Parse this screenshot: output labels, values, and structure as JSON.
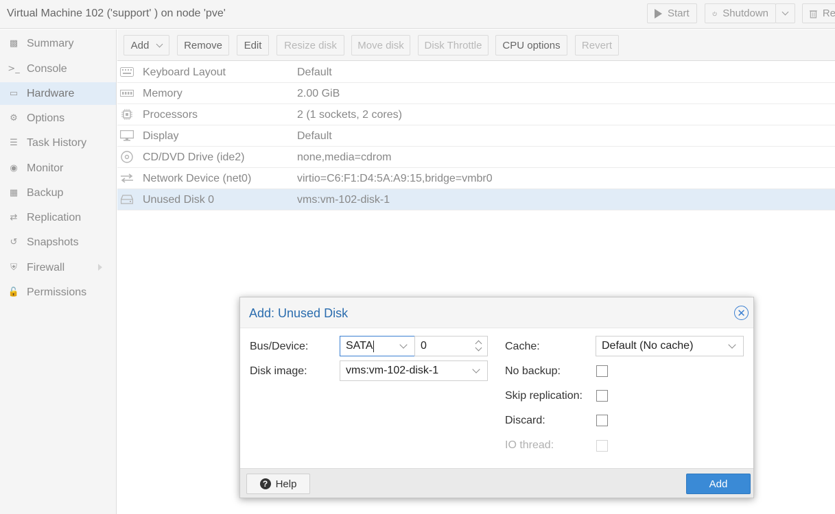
{
  "header": {
    "title": "Virtual Machine 102 ('support' ) on node 'pve'",
    "start_label": "Start",
    "shutdown_label": "Shutdown",
    "remove_label": "Re"
  },
  "sidebar": {
    "items": [
      {
        "label": "Summary",
        "icon": "book-icon"
      },
      {
        "label": "Console",
        "icon": "terminal-icon"
      },
      {
        "label": "Hardware",
        "icon": "desktop-icon",
        "active": true
      },
      {
        "label": "Options",
        "icon": "gear-icon"
      },
      {
        "label": "Task History",
        "icon": "list-icon"
      },
      {
        "label": "Monitor",
        "icon": "eye-icon"
      },
      {
        "label": "Backup",
        "icon": "floppy-icon"
      },
      {
        "label": "Replication",
        "icon": "retweet-icon"
      },
      {
        "label": "Snapshots",
        "icon": "history-icon"
      },
      {
        "label": "Firewall",
        "icon": "shield-icon"
      },
      {
        "label": "Permissions",
        "icon": "unlock-icon"
      }
    ]
  },
  "toolbar": {
    "add": "Add",
    "remove": "Remove",
    "edit": "Edit",
    "resize_disk": "Resize disk",
    "move_disk": "Move disk",
    "disk_throttle": "Disk Throttle",
    "cpu_options": "CPU options",
    "revert": "Revert"
  },
  "hardware": [
    {
      "name": "Keyboard Layout",
      "value": "Default",
      "icon": "keyboard-icon"
    },
    {
      "name": "Memory",
      "value": "2.00 GiB",
      "icon": "memory-icon"
    },
    {
      "name": "Processors",
      "value": "2 (1 sockets, 2 cores)",
      "icon": "cpu-icon"
    },
    {
      "name": "Display",
      "value": "Default",
      "icon": "desktop-icon"
    },
    {
      "name": "CD/DVD Drive (ide2)",
      "value": "none,media=cdrom",
      "icon": "cdrom-icon"
    },
    {
      "name": "Network Device (net0)",
      "value": "virtio=C6:F1:D4:5A:A9:15,bridge=vmbr0",
      "icon": "exchange-icon"
    },
    {
      "name": "Unused Disk 0",
      "value": "vms:vm-102-disk-1",
      "icon": "hdd-icon",
      "selected": true
    }
  ],
  "dialog": {
    "title": "Add: Unused Disk",
    "bus_device_label": "Bus/Device:",
    "bus_value": "SATA",
    "device_number": "0",
    "disk_image_label": "Disk image:",
    "disk_image_value": "vms:vm-102-disk-1",
    "cache_label": "Cache:",
    "cache_value": "Default (No cache)",
    "no_backup_label": "No backup:",
    "skip_replication_label": "Skip replication:",
    "discard_label": "Discard:",
    "io_thread_label": "IO thread:",
    "help_label": "Help",
    "add_label": "Add"
  },
  "colors": {
    "accent": "#3a8ad6",
    "title_blue": "#2a6cae",
    "selected_row": "#e1ecf7"
  }
}
